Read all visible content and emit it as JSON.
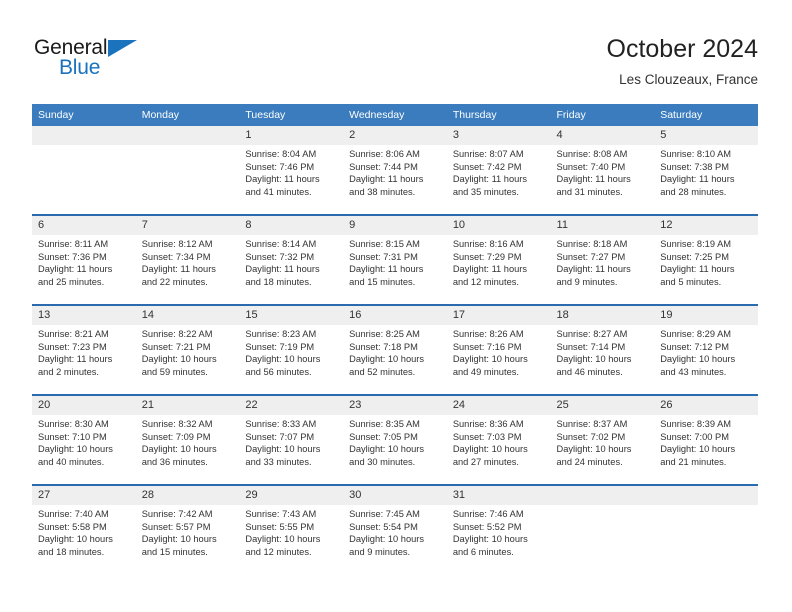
{
  "brand": {
    "name_part1": "General",
    "name_part2": "Blue",
    "accent_color": "#1b72bd",
    "triangle_icon": "brand-triangle-icon"
  },
  "header": {
    "title": "October 2024",
    "subtitle": "Les Clouzeaux, France"
  },
  "theme": {
    "header_bg": "#3a7cbe",
    "row_divider": "#2a6aae",
    "daynum_bg": "#efefef",
    "text": "#333333"
  },
  "calendar": {
    "weekday_headers": [
      "Sunday",
      "Monday",
      "Tuesday",
      "Wednesday",
      "Thursday",
      "Friday",
      "Saturday"
    ],
    "weeks": [
      [
        {
          "day": "",
          "lines": []
        },
        {
          "day": "",
          "lines": []
        },
        {
          "day": "1",
          "lines": [
            "Sunrise: 8:04 AM",
            "Sunset: 7:46 PM",
            "Daylight: 11 hours",
            "and 41 minutes."
          ]
        },
        {
          "day": "2",
          "lines": [
            "Sunrise: 8:06 AM",
            "Sunset: 7:44 PM",
            "Daylight: 11 hours",
            "and 38 minutes."
          ]
        },
        {
          "day": "3",
          "lines": [
            "Sunrise: 8:07 AM",
            "Sunset: 7:42 PM",
            "Daylight: 11 hours",
            "and 35 minutes."
          ]
        },
        {
          "day": "4",
          "lines": [
            "Sunrise: 8:08 AM",
            "Sunset: 7:40 PM",
            "Daylight: 11 hours",
            "and 31 minutes."
          ]
        },
        {
          "day": "5",
          "lines": [
            "Sunrise: 8:10 AM",
            "Sunset: 7:38 PM",
            "Daylight: 11 hours",
            "and 28 minutes."
          ]
        }
      ],
      [
        {
          "day": "6",
          "lines": [
            "Sunrise: 8:11 AM",
            "Sunset: 7:36 PM",
            "Daylight: 11 hours",
            "and 25 minutes."
          ]
        },
        {
          "day": "7",
          "lines": [
            "Sunrise: 8:12 AM",
            "Sunset: 7:34 PM",
            "Daylight: 11 hours",
            "and 22 minutes."
          ]
        },
        {
          "day": "8",
          "lines": [
            "Sunrise: 8:14 AM",
            "Sunset: 7:32 PM",
            "Daylight: 11 hours",
            "and 18 minutes."
          ]
        },
        {
          "day": "9",
          "lines": [
            "Sunrise: 8:15 AM",
            "Sunset: 7:31 PM",
            "Daylight: 11 hours",
            "and 15 minutes."
          ]
        },
        {
          "day": "10",
          "lines": [
            "Sunrise: 8:16 AM",
            "Sunset: 7:29 PM",
            "Daylight: 11 hours",
            "and 12 minutes."
          ]
        },
        {
          "day": "11",
          "lines": [
            "Sunrise: 8:18 AM",
            "Sunset: 7:27 PM",
            "Daylight: 11 hours",
            "and 9 minutes."
          ]
        },
        {
          "day": "12",
          "lines": [
            "Sunrise: 8:19 AM",
            "Sunset: 7:25 PM",
            "Daylight: 11 hours",
            "and 5 minutes."
          ]
        }
      ],
      [
        {
          "day": "13",
          "lines": [
            "Sunrise: 8:21 AM",
            "Sunset: 7:23 PM",
            "Daylight: 11 hours",
            "and 2 minutes."
          ]
        },
        {
          "day": "14",
          "lines": [
            "Sunrise: 8:22 AM",
            "Sunset: 7:21 PM",
            "Daylight: 10 hours",
            "and 59 minutes."
          ]
        },
        {
          "day": "15",
          "lines": [
            "Sunrise: 8:23 AM",
            "Sunset: 7:19 PM",
            "Daylight: 10 hours",
            "and 56 minutes."
          ]
        },
        {
          "day": "16",
          "lines": [
            "Sunrise: 8:25 AM",
            "Sunset: 7:18 PM",
            "Daylight: 10 hours",
            "and 52 minutes."
          ]
        },
        {
          "day": "17",
          "lines": [
            "Sunrise: 8:26 AM",
            "Sunset: 7:16 PM",
            "Daylight: 10 hours",
            "and 49 minutes."
          ]
        },
        {
          "day": "18",
          "lines": [
            "Sunrise: 8:27 AM",
            "Sunset: 7:14 PM",
            "Daylight: 10 hours",
            "and 46 minutes."
          ]
        },
        {
          "day": "19",
          "lines": [
            "Sunrise: 8:29 AM",
            "Sunset: 7:12 PM",
            "Daylight: 10 hours",
            "and 43 minutes."
          ]
        }
      ],
      [
        {
          "day": "20",
          "lines": [
            "Sunrise: 8:30 AM",
            "Sunset: 7:10 PM",
            "Daylight: 10 hours",
            "and 40 minutes."
          ]
        },
        {
          "day": "21",
          "lines": [
            "Sunrise: 8:32 AM",
            "Sunset: 7:09 PM",
            "Daylight: 10 hours",
            "and 36 minutes."
          ]
        },
        {
          "day": "22",
          "lines": [
            "Sunrise: 8:33 AM",
            "Sunset: 7:07 PM",
            "Daylight: 10 hours",
            "and 33 minutes."
          ]
        },
        {
          "day": "23",
          "lines": [
            "Sunrise: 8:35 AM",
            "Sunset: 7:05 PM",
            "Daylight: 10 hours",
            "and 30 minutes."
          ]
        },
        {
          "day": "24",
          "lines": [
            "Sunrise: 8:36 AM",
            "Sunset: 7:03 PM",
            "Daylight: 10 hours",
            "and 27 minutes."
          ]
        },
        {
          "day": "25",
          "lines": [
            "Sunrise: 8:37 AM",
            "Sunset: 7:02 PM",
            "Daylight: 10 hours",
            "and 24 minutes."
          ]
        },
        {
          "day": "26",
          "lines": [
            "Sunrise: 8:39 AM",
            "Sunset: 7:00 PM",
            "Daylight: 10 hours",
            "and 21 minutes."
          ]
        }
      ],
      [
        {
          "day": "27",
          "lines": [
            "Sunrise: 7:40 AM",
            "Sunset: 5:58 PM",
            "Daylight: 10 hours",
            "and 18 minutes."
          ]
        },
        {
          "day": "28",
          "lines": [
            "Sunrise: 7:42 AM",
            "Sunset: 5:57 PM",
            "Daylight: 10 hours",
            "and 15 minutes."
          ]
        },
        {
          "day": "29",
          "lines": [
            "Sunrise: 7:43 AM",
            "Sunset: 5:55 PM",
            "Daylight: 10 hours",
            "and 12 minutes."
          ]
        },
        {
          "day": "30",
          "lines": [
            "Sunrise: 7:45 AM",
            "Sunset: 5:54 PM",
            "Daylight: 10 hours",
            "and 9 minutes."
          ]
        },
        {
          "day": "31",
          "lines": [
            "Sunrise: 7:46 AM",
            "Sunset: 5:52 PM",
            "Daylight: 10 hours",
            "and 6 minutes."
          ]
        },
        {
          "day": "",
          "lines": []
        },
        {
          "day": "",
          "lines": []
        }
      ]
    ]
  }
}
